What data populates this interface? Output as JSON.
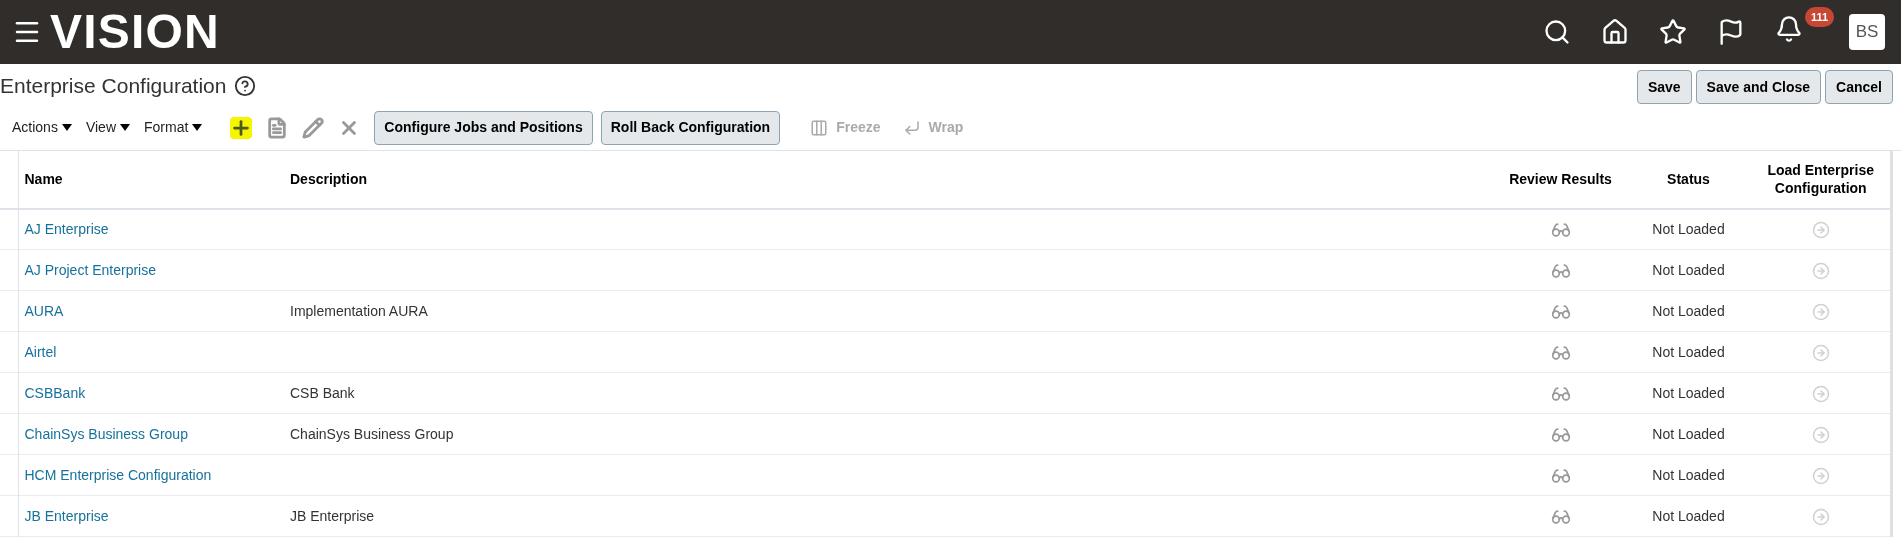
{
  "header": {
    "logo": "VISION",
    "notifications": "111",
    "avatar": "BS"
  },
  "page": {
    "title": "Enterprise Configuration"
  },
  "page_buttons": [
    "Save",
    "Save and Close",
    "Cancel"
  ],
  "toolbar": {
    "menus": [
      "Actions",
      "View",
      "Format"
    ],
    "icons": [
      {
        "kind": "add",
        "disabled": false,
        "highlighted": true
      },
      {
        "kind": "copy",
        "disabled": true,
        "highlighted": false
      },
      {
        "kind": "edit",
        "disabled": true,
        "highlighted": false
      },
      {
        "kind": "delete",
        "disabled": true,
        "highlighted": false
      }
    ],
    "buttons": [
      "Configure Jobs and Positions",
      "Roll Back Configuration"
    ],
    "actions": [
      {
        "kind": "freeze",
        "label": "Freeze",
        "disabled": true
      },
      {
        "kind": "wrap",
        "label": "Wrap",
        "disabled": true
      }
    ]
  },
  "table": {
    "columns": [
      "Name",
      "Description",
      "Review Results",
      "Status",
      "Load Enterprise Configuration"
    ],
    "rows": [
      {
        "name": "AJ Enterprise",
        "description": "",
        "status": "Not Loaded"
      },
      {
        "name": "AJ Project Enterprise",
        "description": "",
        "status": "Not Loaded"
      },
      {
        "name": "AURA",
        "description": "Implementation AURA",
        "status": "Not Loaded"
      },
      {
        "name": "Airtel",
        "description": "",
        "status": "Not Loaded"
      },
      {
        "name": "CSBBank",
        "description": "CSB Bank",
        "status": "Not Loaded"
      },
      {
        "name": "ChainSys Business Group",
        "description": "ChainSys Business Group",
        "status": "Not Loaded"
      },
      {
        "name": "HCM Enterprise Configuration",
        "description": "",
        "status": "Not Loaded"
      },
      {
        "name": "JB Enterprise",
        "description": "JB Enterprise",
        "status": "Not Loaded"
      }
    ]
  }
}
